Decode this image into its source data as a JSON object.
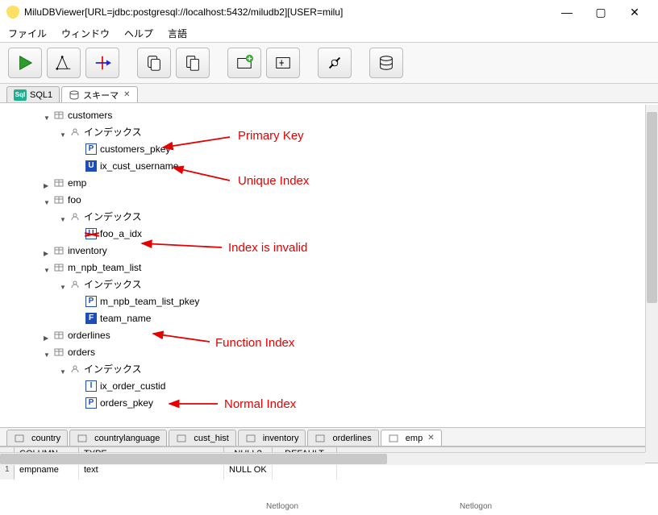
{
  "title": "MiluDBViewer[URL=jdbc:postgresql://localhost:5432/miludb2][USER=milu]",
  "menu": {
    "file": "ファイル",
    "window": "ウィンドウ",
    "help": "ヘルプ",
    "lang": "言語"
  },
  "top_tabs": {
    "sql": "SQL1",
    "schema": "スキーマ"
  },
  "tree": {
    "customers": "customers",
    "indexes": "インデックス",
    "customers_pkey": "customers_pkey",
    "ix_cust_username": "ix_cust_username",
    "emp": "emp",
    "foo": "foo",
    "foo_a_idx": "foo_a_idx",
    "inventory": "inventory",
    "m_npb_team_list": "m_npb_team_list",
    "m_npb_team_list_pkey": "m_npb_team_list_pkey",
    "team_name": "team_name",
    "orderlines": "orderlines",
    "orders": "orders",
    "ix_order_custid": "ix_order_custid",
    "orders_pkey": "orders_pkey"
  },
  "anno": {
    "primary_key": "Primary Key",
    "unique_index": "Unique Index",
    "index_invalid": "Index is invalid",
    "function_index": "Function Index",
    "normal_index": "Normal Index"
  },
  "bottom_tabs": {
    "country": "country",
    "countrylanguage": "countrylanguage",
    "cust_hist": "cust_hist",
    "inventory": "inventory",
    "orderlines": "orderlines",
    "emp": "emp"
  },
  "grid": {
    "h_rownum": "-",
    "h_column": "COLUMN",
    "h_type": "TYPE",
    "h_null": "NULL?",
    "h_default": "DEFAULT",
    "r1_num": "1",
    "r1_col": "empname",
    "r1_type": "text",
    "r1_null": "NULL OK",
    "r1_default": ""
  },
  "status": {
    "a": "Netlogon",
    "b": "Netlogon"
  }
}
